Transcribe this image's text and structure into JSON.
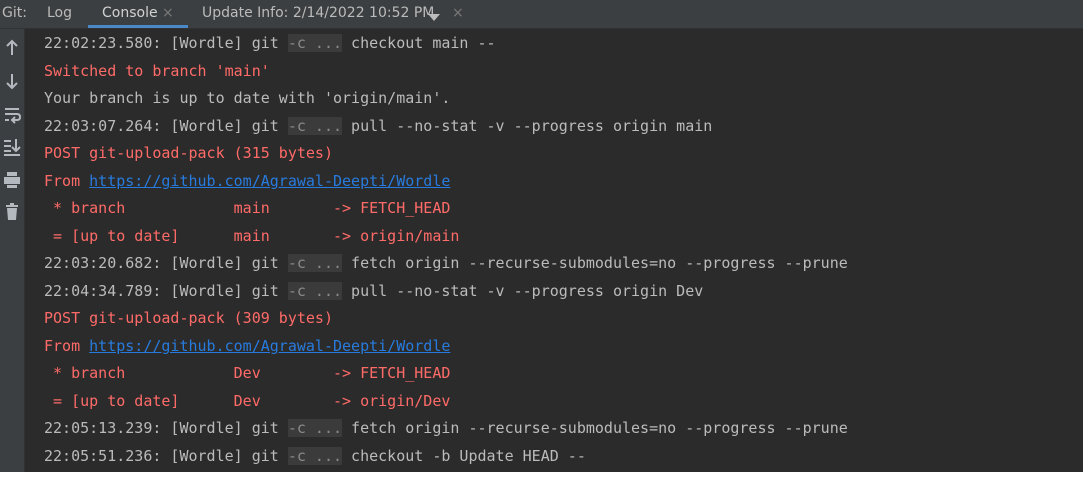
{
  "tabs": {
    "prefix": "Git:",
    "log": "Log",
    "console": "Console",
    "close_glyph": "×",
    "update_info": "Update Info: 2/14/2022 10:52 PM"
  },
  "toolbar_icons": [
    "arrow-up-icon",
    "arrow-down-icon",
    "soft-wrap-icon",
    "scroll-to-end-icon",
    "print-icon",
    "trash-icon"
  ],
  "console": {
    "options_glyph": "-c ...",
    "lines": [
      {
        "type": "cmd",
        "prefix": "22:02:23.580: [Wordle] git ",
        "suffix": " checkout main --"
      },
      {
        "type": "red",
        "text": "Switched to branch 'main'"
      },
      {
        "type": "plain",
        "text": "Your branch is up to date with 'origin/main'."
      },
      {
        "type": "cmd",
        "prefix": "22:03:07.264: [Wordle] git ",
        "suffix": " pull --no-stat -v --progress origin main"
      },
      {
        "type": "red",
        "text": "POST git-upload-pack (315 bytes)"
      },
      {
        "type": "from",
        "text": "From ",
        "link": "https://github.com/Agrawal-Deepti/Wordle"
      },
      {
        "type": "red",
        "text": " * branch            main       -> FETCH_HEAD"
      },
      {
        "type": "red",
        "text": " = [up to date]      main       -> origin/main"
      },
      {
        "type": "cmd",
        "prefix": "22:03:20.682: [Wordle] git ",
        "suffix": " fetch origin --recurse-submodules=no --progress --prune"
      },
      {
        "type": "cmd",
        "prefix": "22:04:34.789: [Wordle] git ",
        "suffix": " pull --no-stat -v --progress origin Dev"
      },
      {
        "type": "red",
        "text": "POST git-upload-pack (309 bytes)"
      },
      {
        "type": "from",
        "text": "From ",
        "link": "https://github.com/Agrawal-Deepti/Wordle"
      },
      {
        "type": "red",
        "text": " * branch            Dev        -> FETCH_HEAD"
      },
      {
        "type": "red",
        "text": " = [up to date]      Dev        -> origin/Dev"
      },
      {
        "type": "cmd",
        "prefix": "22:05:13.239: [Wordle] git ",
        "suffix": " fetch origin --recurse-submodules=no --progress --prune"
      },
      {
        "type": "cmd",
        "prefix": "22:05:51.236: [Wordle] git ",
        "suffix": " checkout -b Update HEAD --"
      }
    ]
  }
}
